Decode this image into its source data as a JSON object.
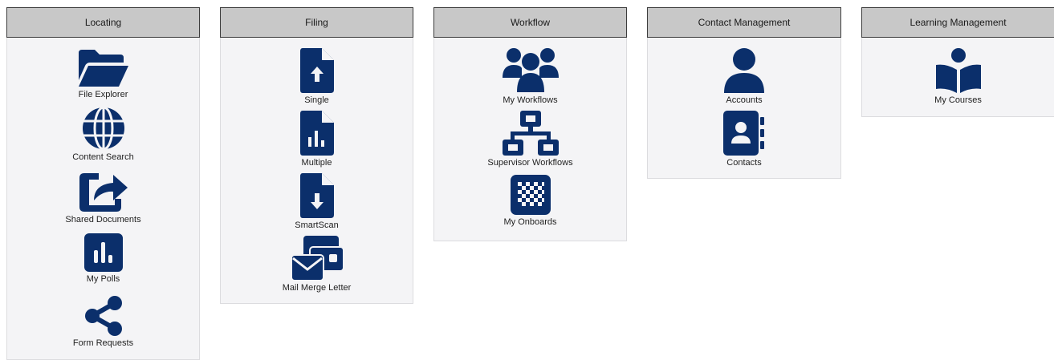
{
  "theme": {
    "icon_color": "#0b2f6b",
    "header_bg": "#c8c8c8",
    "panel_bg": "#f4f4f6"
  },
  "panels": [
    {
      "title": "Locating",
      "items": [
        {
          "label": "File Explorer",
          "icon": "folder-open-icon"
        },
        {
          "label": "Content Search",
          "icon": "globe-icon"
        },
        {
          "label": "Shared Documents",
          "icon": "share-square-icon"
        },
        {
          "label": "My Polls",
          "icon": "poll-icon"
        },
        {
          "label": "Form Requests",
          "icon": "share-nodes-icon"
        }
      ]
    },
    {
      "title": "Filing",
      "items": [
        {
          "label": "Single",
          "icon": "file-upload-icon"
        },
        {
          "label": "Multiple",
          "icon": "file-chart-icon"
        },
        {
          "label": "SmartScan",
          "icon": "file-download-icon"
        },
        {
          "label": "Mail Merge Letter",
          "icon": "mail-merge-icon"
        }
      ]
    },
    {
      "title": "Workflow",
      "items": [
        {
          "label": "My Workflows",
          "icon": "users-group-icon"
        },
        {
          "label": "Supervisor Workflows",
          "icon": "sitemap-icon"
        },
        {
          "label": "My Onboards",
          "icon": "checkered-square-icon"
        }
      ]
    },
    {
      "title": "Contact Management",
      "items": [
        {
          "label": "Accounts",
          "icon": "user-icon"
        },
        {
          "label": "Contacts",
          "icon": "address-book-icon"
        }
      ]
    },
    {
      "title": "Learning Management",
      "items": [
        {
          "label": "My Courses",
          "icon": "book-reader-icon"
        }
      ]
    }
  ]
}
